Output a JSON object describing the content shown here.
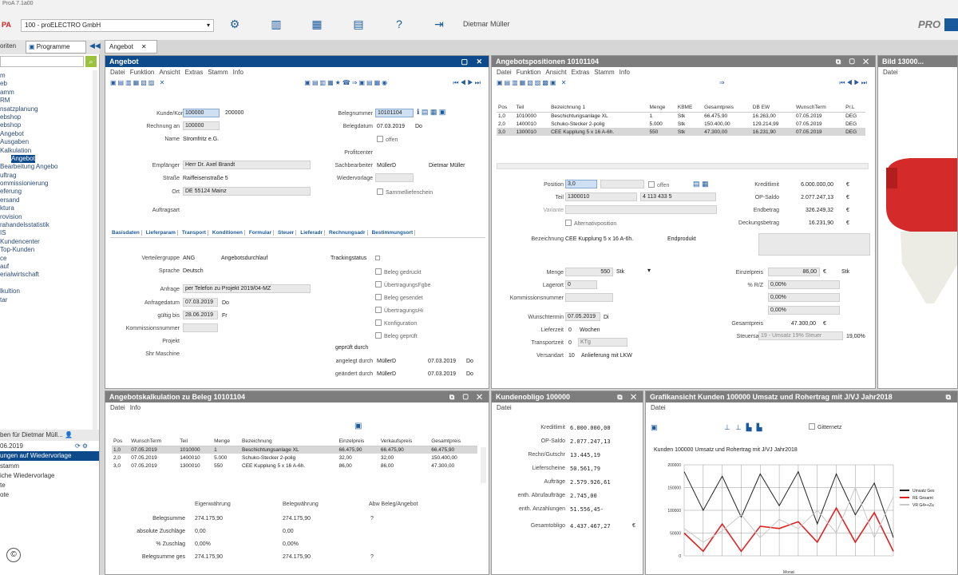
{
  "window_title": "ProA 7.1a00",
  "toolbar": {
    "company_select": "100 - proELECTRO GmbH",
    "user": "Dietmar Müller",
    "brand": "PRO"
  },
  "left_tabs": [
    "oriten",
    "Programme"
  ],
  "sidebar": {
    "items": [
      "m",
      "eb",
      "amm",
      "RM",
      "nsatzplanung",
      "ebshop",
      "ebshop",
      "Angebot",
      "Ausgaben",
      "Kalkulation",
      "Angebot",
      "Bearbeitung Angebo",
      "uftrag",
      "ommissionierung",
      "eferung",
      "ersand",
      "ktura",
      "rovision",
      "rahandelsstatistik",
      "IS",
      "Kundencenter",
      "Top-Kunden",
      "ce",
      "auf",
      "erialwirtschaft",
      "",
      "lkultion",
      "tar"
    ],
    "footer_title": "ben für Dietmar Müll...",
    "footer_date": "06.2019",
    "footer_active": "ungen auf Wiedervorlage",
    "footer_items": [
      "stamm",
      "iche Wiedervorlage",
      "te",
      "ote"
    ]
  },
  "doc_tab": "Angebot",
  "angebot": {
    "title": "Angebot",
    "menu": [
      "Datei",
      "Funktion",
      "Ansicht",
      "Extras",
      "Stamm",
      "Info"
    ],
    "fields": {
      "kunde_label": "Kunde/Kontakt",
      "kunde_val": "100000",
      "kunde_val2": "200000",
      "rechnung_label": "Rechnung an",
      "rechnung_val": "100000",
      "name_label": "Name",
      "name_val": "Stromfritz e.G.",
      "empf_label": "Empfänger",
      "empf_val": "Herr Dr. Axel Brandt",
      "strasse_label": "Straße",
      "strasse_val": "Raiffeisenstraße 5",
      "ort_label": "Ort",
      "ort_val": "DE 55124 Mainz",
      "auftrag_label": "Auftragsart",
      "belegnr_label": "Belegnummer",
      "belegnr_val": "10101104",
      "belegdat_label": "Belegdatum",
      "belegdat_val": "07.03.2019",
      "belegdat_unit": "Do",
      "offen_label": "offen",
      "profit_label": "Profitcenter",
      "sach_label": "Sachbearbeiter",
      "sach_val": "MüllerD",
      "sach_name": "Dietmar Müller",
      "wieder_label": "Wiedervorlage",
      "sammel_label": "Sammelliefenchein"
    },
    "tabs": [
      "Basisdaten",
      "Lieferparam",
      "Transport",
      "Konditionen",
      "Formular",
      "Steuer",
      "Lieferadr",
      "Rechnungsadr",
      "Bestimmungsort"
    ],
    "basis": {
      "verteiler_label": "Verteilergruppe",
      "verteiler_val": "ANG",
      "verteiler_desc": "Angebotsdurchlauf",
      "sprache_label": "Sprache",
      "sprache_val": "Deutsch",
      "anfrage_label": "Anfrage",
      "anfrage_val": "per Telefon zu Projekt 2019/04-MZ",
      "anfragedat_label": "Anfragedatum",
      "anfragedat_val": "07.03.2019",
      "anfragedat_unit": "Do",
      "gueltig_label": "gültig bis",
      "gueltig_val": "28.06.2019",
      "gueltig_unit": "Fr",
      "kommnr_label": "Kommissionsnummer",
      "projekt_label": "Projekt",
      "maschine_label": "Shr Maschine",
      "tracking_label": "Trackingstatus",
      "checks": [
        "Beleg gedruckt",
        "ÜbertragungsFgbe",
        "Beleg gesendet",
        "ÜbertragungsHi",
        "Konfiguration",
        "Beleg geprüft"
      ],
      "geprueft_label": "geprüft durch",
      "angelegt_label": "angelegt durch",
      "angelegt_val": "MüllerD",
      "angelegt_date": "07.03.2019",
      "angelegt_unit": "Do",
      "geaendert_label": "geändert durch",
      "geaendert_val": "MüllerD",
      "geaendert_date": "07.03.2019",
      "geaendert_unit": "Do"
    }
  },
  "positionen": {
    "title": "Angebotspositionen 10101104",
    "menu": [
      "Datei",
      "Funktion",
      "Ansicht",
      "Extras",
      "Stamm",
      "Info"
    ],
    "columns": [
      "Pos",
      "Teil",
      "Bezeichnung 1",
      "Menge",
      "KBME",
      "Gesamtpreis",
      "DB EW",
      "WunschTerm",
      "Pr.L"
    ],
    "rows": [
      [
        "1,0",
        "1010000",
        "Beschichtungsanlage XL",
        "1",
        "Stk",
        "66.475,90",
        "16.263,00",
        "07.05.2019",
        "DEG"
      ],
      [
        "2,0",
        "1400010",
        "Schuko-Stecker 2-polig",
        "5.000",
        "Stk",
        "150.400,00",
        "129.214,99",
        "07.05.2019",
        "DEG"
      ],
      [
        "3,0",
        "1300010",
        "CEE Kupplung 5 x 16 A-6h.",
        "550",
        "Stk",
        "47.300,00",
        "16.231,90",
        "07.05.2019",
        "DEG"
      ]
    ],
    "detail": {
      "position_label": "Position",
      "position_val": "3,0",
      "offen_label": "offen",
      "teil_label": "Teil",
      "teil_val": "1300010",
      "teil_val2": "4 113 433 5",
      "variante_label": "Variante",
      "alt_label": "Alternativposition",
      "bez_label": "Bezeichnung",
      "bez_val": "CEE Kupplung 5 x 16 A-6h.",
      "bez_extra": "Endprodukt",
      "menge_label": "Menge",
      "menge_val": "550",
      "menge_unit": "Stk",
      "lager_label": "Lagerort",
      "lager_val": "0",
      "komm_label": "Kommissionsnummer",
      "wunsch_label": "Wunschtermin",
      "wunsch_val": "07.05.2019",
      "wunsch_unit": "Di",
      "lieferzeit_label": "Lieferzeit",
      "lieferzeit_val": "0",
      "lieferzeit_unit": "Wochen",
      "transport_label": "Transportzeit",
      "transport_val": "0",
      "transport_unit": "KTg",
      "versand_label": "Versandart",
      "versand_val": "10",
      "versand_desc": "Anlieferung mit LKW",
      "kredit_label": "Kreditlimit",
      "kredit_val": "6.000.000,00",
      "cur": "€",
      "op_label": "OP-Saldo",
      "op_val": "2.077.247,13",
      "endbetrag_label": "Endbetrag",
      "endbetrag_val": "326.249,32",
      "deckung_label": "Deckungsbetrag",
      "deckung_val": "16.231,90",
      "einzel_label": "Einzelpreis",
      "einzel_val": "86,00",
      "einzel_unit": "Stk",
      "rz_label": "% R/Z",
      "rz_val": "0,00%",
      "r2_val": "0,00%",
      "r3_val": "0,00%",
      "gesamt_label": "Gesamtpreis",
      "gesamt_val": "47.300,00",
      "steuer_label": "Steuersatz",
      "steuer_val": "19 - Umsatz 19% Steuer",
      "steuer_pct": "19,00%"
    }
  },
  "bild": {
    "title": "Bild 13000...",
    "menu": "Datei"
  },
  "kalkulation": {
    "title": "Angebotskalkulation zu Beleg 10101104",
    "menu": [
      "Datei",
      "Info"
    ],
    "columns": [
      "Pos",
      "WunschTerm",
      "Teil",
      "Menge",
      "Bezeichnung",
      "Einzelpreis",
      "Verkaufspreis",
      "Gesamtpreis"
    ],
    "rows": [
      [
        "1,0",
        "07.05.2019",
        "1010000",
        "1",
        "Beschichtungsanlage XL",
        "66.475,90",
        "66.475,90",
        "66.475,90"
      ],
      [
        "2,0",
        "07.05.2019",
        "1400010",
        "5.000",
        "Schuko-Stecker 2-polig",
        "32,00",
        "32,00",
        "150.400,00"
      ],
      [
        "3,0",
        "07.05.2019",
        "1300010",
        "550",
        "CEE Kupplung 5 x 16 A-6h.",
        "86,00",
        "86,00",
        "47.300,00"
      ]
    ],
    "summary_headers": [
      "Eigenwährung",
      "Belegwährung",
      "Abw Beleg/Angebot"
    ],
    "summary": [
      [
        "Belegsumme",
        "274.175,90",
        "274.175,90",
        "?"
      ],
      [
        "absolute Zuschläge",
        "0,00",
        "0,00",
        ""
      ],
      [
        "% Zuschlag",
        "0,00%",
        "0,00%",
        ""
      ],
      [
        "Belegsumme ges",
        "274.175,90",
        "274.175,90",
        "?"
      ]
    ]
  },
  "obligo": {
    "title": "Kundenobligo 100000",
    "menu": "Datei",
    "rows": [
      [
        "Kreditlimit",
        "6.000.000,00"
      ],
      [
        "OP-Saldo",
        "2.077.247,13"
      ],
      [
        "Rechn/Gutschr",
        "13.445,19"
      ],
      [
        "Lieferscheine",
        "50.561,79"
      ],
      [
        "Aufträge",
        "2.579.926,61"
      ],
      [
        "enth. Abrufaufträge",
        "2.745,00"
      ],
      [
        "enth. Anzahlungen",
        "51.556,45-"
      ],
      [
        "Gesamtobligo",
        "4.437.467,27"
      ]
    ],
    "cur": "€"
  },
  "grafik": {
    "title": "Grafikansicht Kunden 100000 Umsatz und Rohertrag mit J/VJ  Jahr2018",
    "menu": "Datei",
    "gitter_label": "Gitternetz"
  },
  "chart_data": {
    "type": "line",
    "title": "Kunden 100000 Umsatz und Rohertrag mit J/VJ  Jahr2018",
    "xlabel": "Monat",
    "ylabel": "",
    "ylim": [
      0,
      200000
    ],
    "yticks": [
      "0",
      "50000",
      "100000",
      "150000",
      "200000"
    ],
    "grid": true,
    "legend_position": "right",
    "x": [
      1,
      2,
      3,
      4,
      5,
      6,
      7,
      8,
      9,
      10,
      11,
      12
    ],
    "series": [
      {
        "name": "Umsatz Ges",
        "color": "#222222",
        "values": [
          185000,
          100000,
          175000,
          85000,
          180000,
          110000,
          185000,
          70000,
          180000,
          90000,
          160000,
          40000
        ]
      },
      {
        "name": "RE Gesamt",
        "color": "#e02020",
        "values": [
          50000,
          10000,
          70000,
          10000,
          65000,
          60000,
          75000,
          30000,
          105000,
          30000,
          95000,
          10000
        ]
      },
      {
        "name": "VR G4++Zu",
        "color": "#c8c8c8",
        "values": [
          60000,
          30000,
          55000,
          90000,
          40000,
          80000,
          60000,
          100000,
          50000,
          150000,
          40000,
          130000
        ]
      }
    ]
  }
}
